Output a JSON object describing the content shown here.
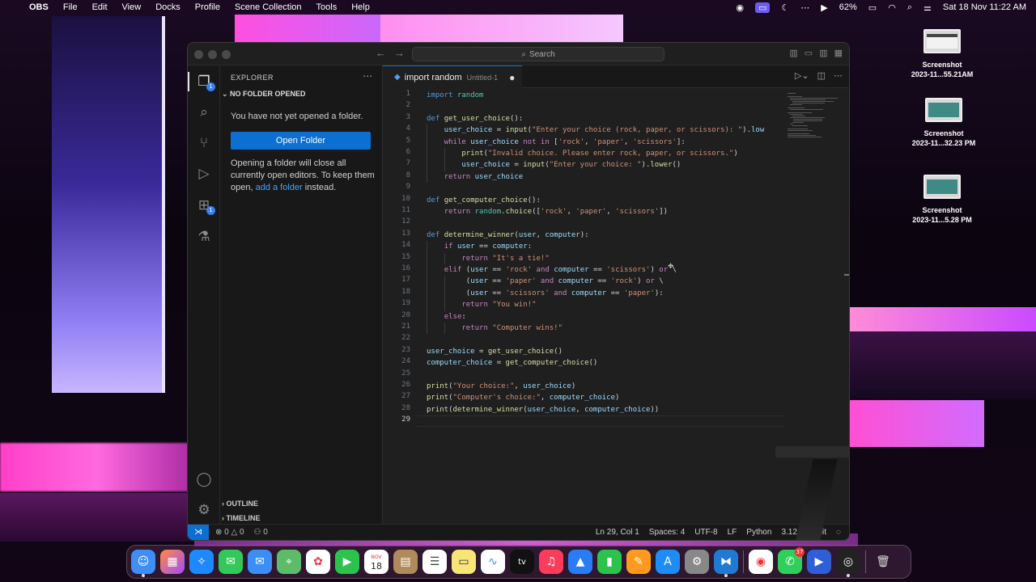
{
  "menubar": {
    "items": [
      "OBS",
      "File",
      "Edit",
      "View",
      "Docks",
      "Profile",
      "Scene Collection",
      "Tools",
      "Help"
    ],
    "battery": "62%",
    "datetime": "Sat 18 Nov  11:22 AM"
  },
  "desktop": [
    {
      "name": "Screenshot",
      "detail": "2023-11...55.21AM"
    },
    {
      "name": "Screenshot",
      "detail": "2023-11...32.23 PM"
    },
    {
      "name": "Screenshot",
      "detail": "2023-11...5.28 PM"
    }
  ],
  "vscode": {
    "search_placeholder": "Search",
    "explorer_title": "EXPLORER",
    "no_folder": "NO FOLDER OPENED",
    "not_opened_text": "You have not yet opened a folder.",
    "open_folder": "Open Folder",
    "para_pre": "Opening a folder will close all currently open editors. To keep them open, ",
    "para_link": "add a folder",
    "para_post": " instead.",
    "outline": "OUTLINE",
    "timeline": "TIMELINE",
    "explorer_badge": "1",
    "extensions_badge": "1",
    "tab": {
      "name": "import random",
      "sub": "Untitled-1"
    },
    "status": {
      "errors": "0",
      "warnings": "0",
      "ports": "0",
      "position": "Ln 29, Col 1",
      "spaces": "Spaces: 4",
      "encoding": "UTF-8",
      "eol": "LF",
      "language": "Python",
      "interpreter": "3.12.0 64-bit"
    },
    "current_line": 29
  },
  "code": [
    "import random",
    "",
    "def get_user_choice():",
    "    user_choice = input(\"Enter your choice (rock, paper, or scissors): \").low",
    "    while user_choice not in ['rock', 'paper', 'scissors']:",
    "        print(\"Invalid choice. Please enter rock, paper, or scissors.\")",
    "        user_choice = input(\"Enter your choice: \").lower()",
    "    return user_choice",
    "",
    "def get_computer_choice():",
    "    return random.choice(['rock', 'paper', 'scissors'])",
    "",
    "def determine_winner(user, computer):",
    "    if user == computer:",
    "        return \"It's a tie!\"",
    "    elif (user == 'rock' and computer == 'scissors') or \\",
    "         (user == 'paper' and computer == 'rock') or \\",
    "         (user == 'scissors' and computer == 'paper'):",
    "        return \"You win!\"",
    "    else:",
    "        return \"Computer wins!\"",
    "",
    "user_choice = get_user_choice()",
    "computer_choice = get_computer_choice()",
    "",
    "print(\"Your choice:\", user_choice)",
    "print(\"Computer's choice:\", computer_choice)",
    "print(determine_winner(user_choice, computer_choice))",
    ""
  ],
  "dock": {
    "calendar_month": "NOV",
    "calendar_day": "18",
    "whatsapp_badge": "37",
    "tv_label": "tv"
  }
}
